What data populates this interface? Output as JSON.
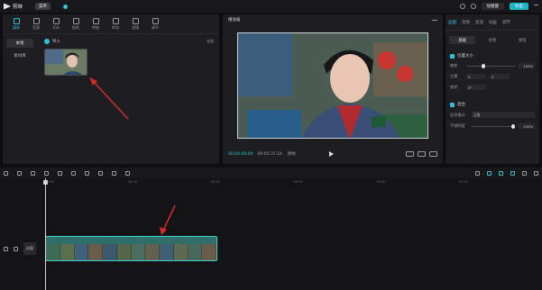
{
  "app": {
    "name": "剪映",
    "menu_label": "菜单",
    "draft_title": ""
  },
  "titlebar": {
    "share_label": "快捷键",
    "export_label": "导出"
  },
  "media_tabs": [
    {
      "label": "媒体",
      "icon": "media-icon",
      "active": true
    },
    {
      "label": "音频",
      "icon": "audio-icon"
    },
    {
      "label": "文本",
      "icon": "text-icon"
    },
    {
      "label": "贴纸",
      "icon": "sticker-icon"
    },
    {
      "label": "特效",
      "icon": "effects-icon"
    },
    {
      "label": "转场",
      "icon": "transition-icon"
    },
    {
      "label": "滤镜",
      "icon": "filter-icon"
    },
    {
      "label": "调节",
      "icon": "adjust-icon"
    }
  ],
  "media_side": [
    {
      "label": "本地",
      "active": true
    },
    {
      "label": "素材库",
      "active": false
    }
  ],
  "media_area": {
    "import_label": "导入",
    "sort_label": "全部",
    "thumb_caption_left": "",
    "thumb_caption_right": "",
    "thumb_meta": ""
  },
  "player": {
    "title": "播放器",
    "timecode_current": "00:00:00:00",
    "timecode_total": "00:03:37:24",
    "ratio_label": "原始"
  },
  "props": {
    "tabs": [
      {
        "label": "画面",
        "active": true
      },
      {
        "label": "音频"
      },
      {
        "label": "变速"
      },
      {
        "label": "动画"
      },
      {
        "label": "调节"
      }
    ],
    "subtabs": [
      {
        "label": "基础",
        "active": true
      },
      {
        "label": "抠像"
      },
      {
        "label": "蒙版"
      }
    ],
    "section_position": "位置大小",
    "scale_label": "缩放",
    "scale_value": "100%",
    "scale_level": 0.35,
    "position_label": "位置",
    "pos_x": "0",
    "pos_y": "0",
    "rotate_label": "旋转",
    "rotate_value": "0°",
    "section_blend": "混合",
    "blend_mode_label": "混合模式",
    "blend_mode_value": "正常",
    "opacity_label": "不透明度",
    "opacity_value": "100%",
    "opacity_level": 1.0
  },
  "timeline": {
    "ruler_marks": [
      "00:00",
      "00:10",
      "00:20",
      "00:30",
      "00:40",
      "00:50"
    ],
    "cover_label": "封面",
    "clip_label": ""
  },
  "colors": {
    "accent": "#2ec4d8",
    "clip": "#2f6e6a",
    "arrow": "#d42a2a"
  }
}
